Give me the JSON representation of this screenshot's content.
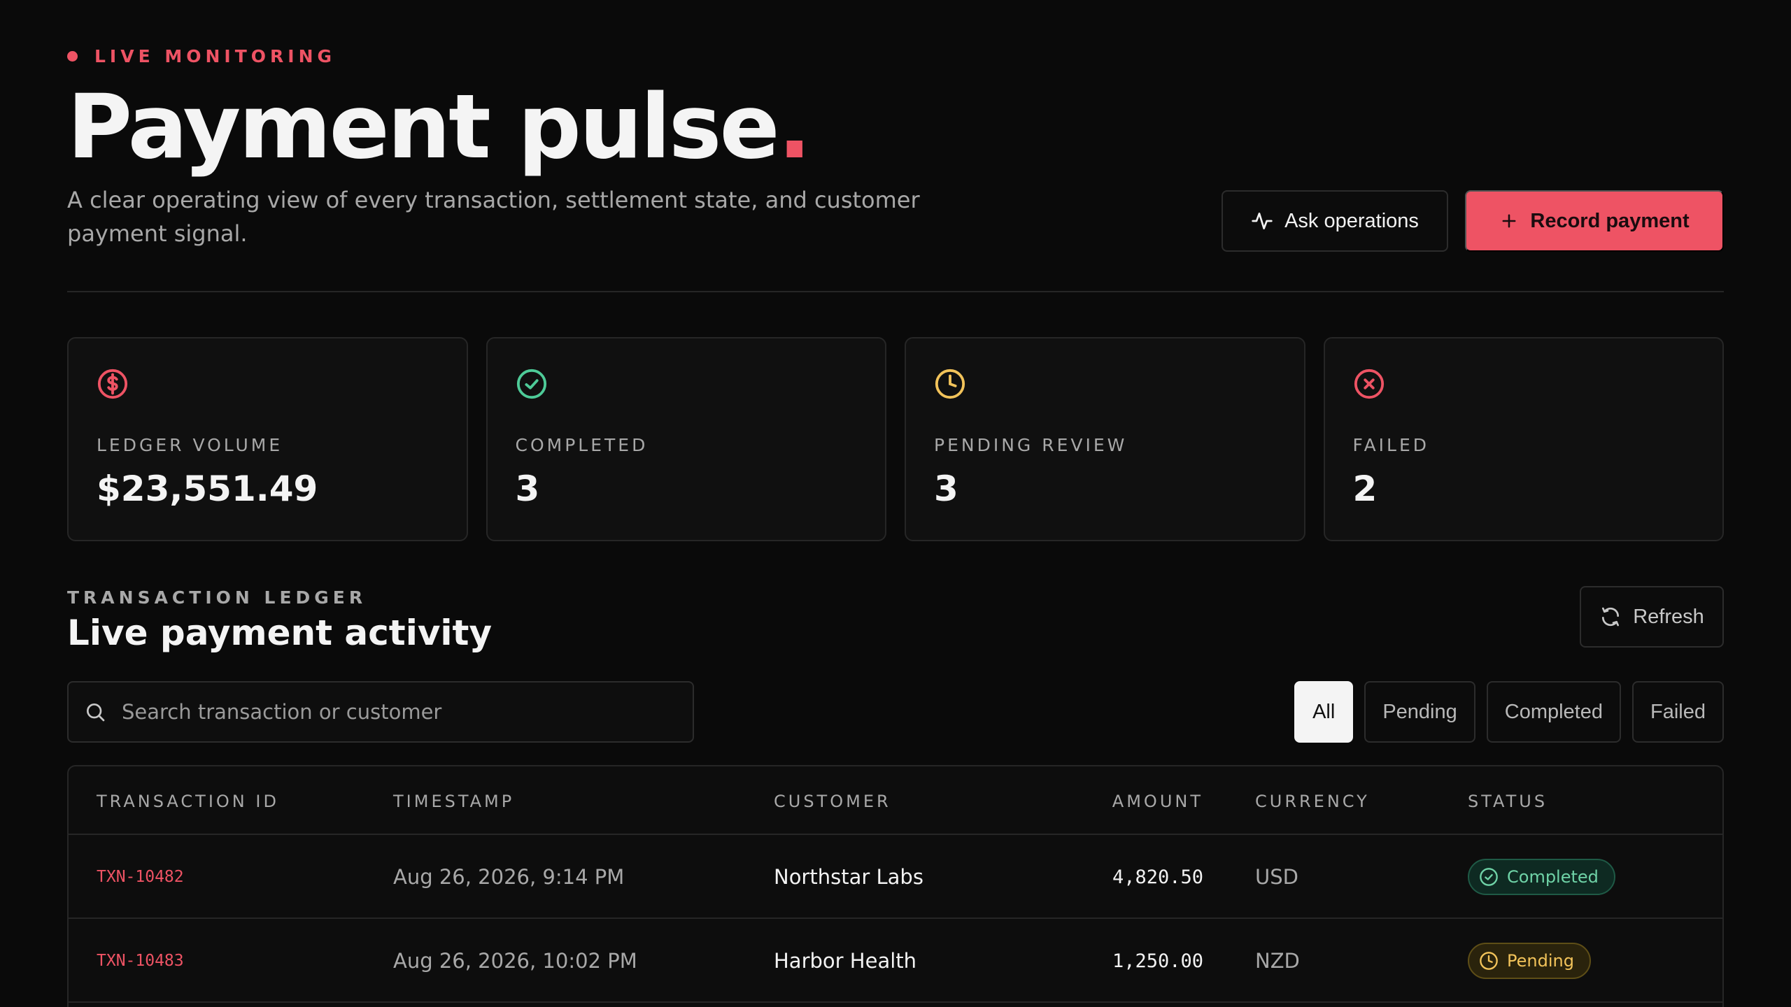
{
  "header": {
    "live_label": "LIVE MONITORING",
    "title": "Payment pulse",
    "title_accent": ".",
    "subtitle": "A clear operating view of every transaction, settlement state, and customer payment signal.",
    "ask_label": "Ask operations",
    "record_label": "Record payment"
  },
  "colors": {
    "accent": "#ee5364",
    "success": "#4ecb98",
    "warning": "#f2c35a",
    "background": "#0a0a0a"
  },
  "stats": [
    {
      "icon": "dollar-circle-icon",
      "label": "LEDGER VOLUME",
      "value": "$23,551.49"
    },
    {
      "icon": "check-circle-icon",
      "label": "COMPLETED",
      "value": "3"
    },
    {
      "icon": "clock-icon",
      "label": "PENDING REVIEW",
      "value": "3"
    },
    {
      "icon": "x-circle-icon",
      "label": "FAILED",
      "value": "2"
    }
  ],
  "ledger": {
    "eyebrow": "TRANSACTION LEDGER",
    "title": "Live payment activity",
    "refresh_label": "Refresh",
    "search_placeholder": "Search transaction or customer",
    "filters": [
      "All",
      "Pending",
      "Completed",
      "Failed"
    ],
    "active_filter": "All",
    "columns": [
      "TRANSACTION ID",
      "TIMESTAMP",
      "CUSTOMER",
      "AMOUNT",
      "CURRENCY",
      "STATUS"
    ],
    "rows": [
      {
        "id": "TXN-10482",
        "timestamp": "Aug 26, 2026, 9:14 PM",
        "customer": "Northstar Labs",
        "amount": "4,820.50",
        "currency": "USD",
        "status": "Completed"
      },
      {
        "id": "TXN-10483",
        "timestamp": "Aug 26, 2026, 10:02 PM",
        "customer": "Harbor Health",
        "amount": "1,250.00",
        "currency": "NZD",
        "status": "Pending"
      }
    ]
  }
}
